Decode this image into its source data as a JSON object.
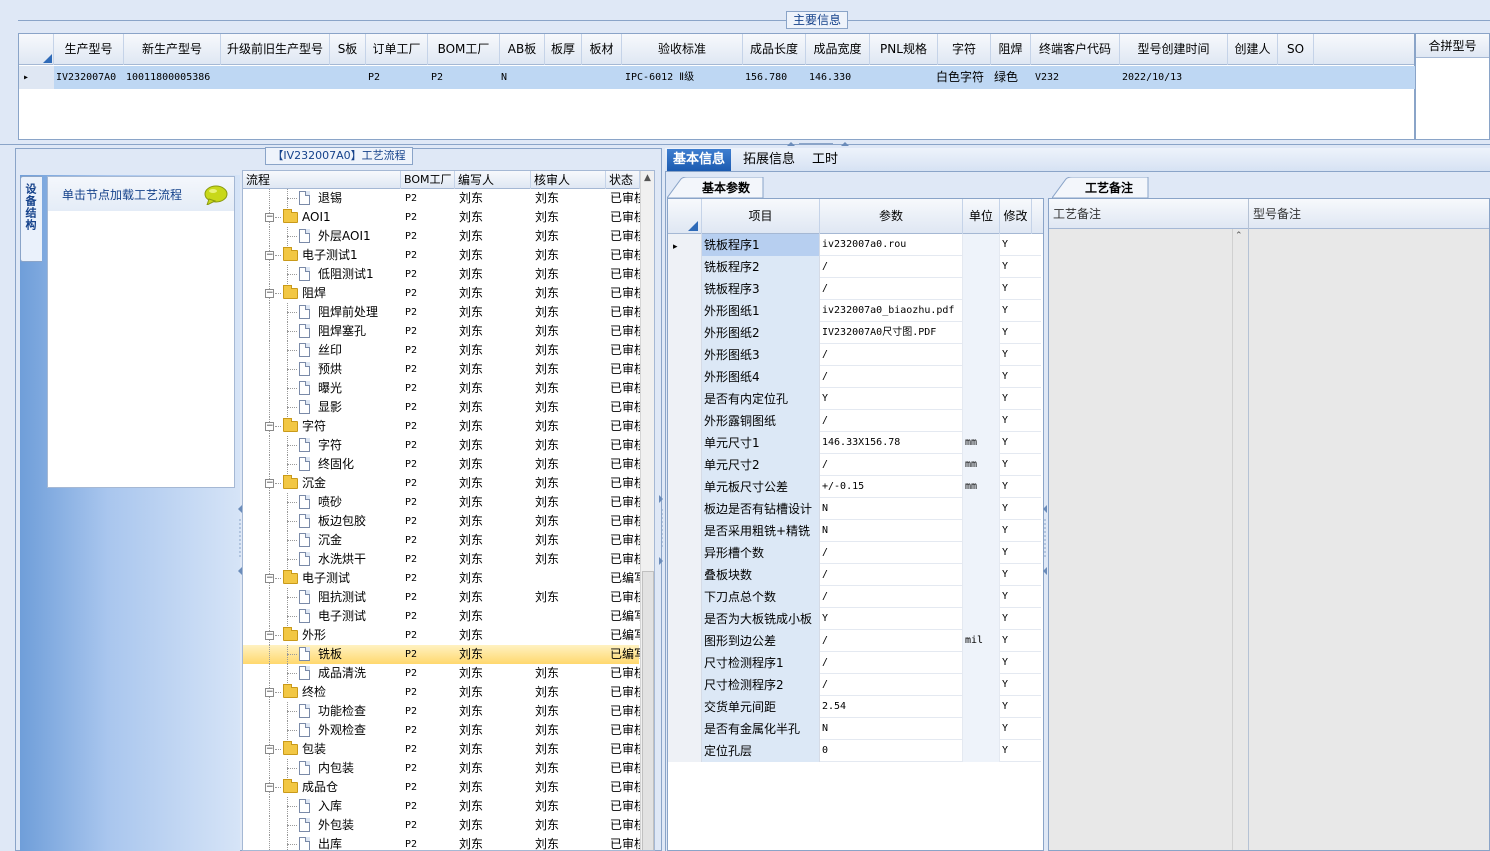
{
  "top": {
    "title": "主要信息",
    "columns": [
      "生产型号",
      "新生产型号",
      "升级前旧生产型号",
      "S板",
      "订单工厂",
      "BOM工厂",
      "AB板",
      "板厚",
      "板材",
      "验收标准",
      "成品长度",
      "成品宽度",
      "PNL规格",
      "字符",
      "阻焊",
      "终端客户代码",
      "型号创建时间",
      "创建人",
      "SO"
    ],
    "row": {
      "model": "IV232007A0",
      "new_model": "10011800005386",
      "order_factory": "P2",
      "bom_factory": "P2",
      "ab": "N",
      "standard": "IPC-6012 Ⅱ级",
      "length": "156.780",
      "width": "146.330",
      "char": "白色字符",
      "solder": "绿色",
      "customer": "V232",
      "created": "2022/10/13"
    },
    "merge_header": "合拼型号"
  },
  "left": {
    "flow_title": "【IV232007A0】工艺流程",
    "side_tab": "设备结构",
    "node_hint": "单击节点加载工艺流程",
    "tree_headers": [
      "流程",
      "BOM工厂",
      "编写人",
      "核审人",
      "状态"
    ],
    "tree_rows": [
      {
        "name": "退锡",
        "lvl": 2,
        "bom": "P2",
        "writer": "刘东",
        "checker": "刘东",
        "status": "已审核"
      },
      {
        "name": "AOI1",
        "lvl": 1,
        "bom": "P2",
        "writer": "刘东",
        "checker": "刘东",
        "status": "已审核"
      },
      {
        "name": "外层AOI1",
        "lvl": 2,
        "bom": "P2",
        "writer": "刘东",
        "checker": "刘东",
        "status": "已审核"
      },
      {
        "name": "电子测试1",
        "lvl": 1,
        "bom": "P2",
        "writer": "刘东",
        "checker": "刘东",
        "status": "已审核"
      },
      {
        "name": "低阻测试1",
        "lvl": 2,
        "bom": "P2",
        "writer": "刘东",
        "checker": "刘东",
        "status": "已审核"
      },
      {
        "name": "阻焊",
        "lvl": 1,
        "bom": "P2",
        "writer": "刘东",
        "checker": "刘东",
        "status": "已审核"
      },
      {
        "name": "阻焊前处理",
        "lvl": 2,
        "bom": "P2",
        "writer": "刘东",
        "checker": "刘东",
        "status": "已审核"
      },
      {
        "name": "阻焊塞孔",
        "lvl": 2,
        "bom": "P2",
        "writer": "刘东",
        "checker": "刘东",
        "status": "已审核"
      },
      {
        "name": "丝印",
        "lvl": 2,
        "bom": "P2",
        "writer": "刘东",
        "checker": "刘东",
        "status": "已审核"
      },
      {
        "name": "预烘",
        "lvl": 2,
        "bom": "P2",
        "writer": "刘东",
        "checker": "刘东",
        "status": "已审核"
      },
      {
        "name": "曝光",
        "lvl": 2,
        "bom": "P2",
        "writer": "刘东",
        "checker": "刘东",
        "status": "已审核"
      },
      {
        "name": "显影",
        "lvl": 2,
        "bom": "P2",
        "writer": "刘东",
        "checker": "刘东",
        "status": "已审核"
      },
      {
        "name": "字符",
        "lvl": 1,
        "bom": "P2",
        "writer": "刘东",
        "checker": "刘东",
        "status": "已审核"
      },
      {
        "name": "字符",
        "lvl": 2,
        "bom": "P2",
        "writer": "刘东",
        "checker": "刘东",
        "status": "已审核"
      },
      {
        "name": "终固化",
        "lvl": 2,
        "bom": "P2",
        "writer": "刘东",
        "checker": "刘东",
        "status": "已审核"
      },
      {
        "name": "沉金",
        "lvl": 1,
        "bom": "P2",
        "writer": "刘东",
        "checker": "刘东",
        "status": "已审核"
      },
      {
        "name": "喷砂",
        "lvl": 2,
        "bom": "P2",
        "writer": "刘东",
        "checker": "刘东",
        "status": "已审核"
      },
      {
        "name": "板边包胶",
        "lvl": 2,
        "bom": "P2",
        "writer": "刘东",
        "checker": "刘东",
        "status": "已审核"
      },
      {
        "name": "沉金",
        "lvl": 2,
        "bom": "P2",
        "writer": "刘东",
        "checker": "刘东",
        "status": "已审核"
      },
      {
        "name": "水洗烘干",
        "lvl": 2,
        "bom": "P2",
        "writer": "刘东",
        "checker": "刘东",
        "status": "已审核"
      },
      {
        "name": "电子测试",
        "lvl": 1,
        "bom": "P2",
        "writer": "刘东",
        "checker": "",
        "status": "已编写"
      },
      {
        "name": "阻抗测试",
        "lvl": 2,
        "bom": "P2",
        "writer": "刘东",
        "checker": "刘东",
        "status": "已审核"
      },
      {
        "name": "电子测试",
        "lvl": 2,
        "bom": "P2",
        "writer": "刘东",
        "checker": "",
        "status": "已编写"
      },
      {
        "name": "外形",
        "lvl": 1,
        "bom": "P2",
        "writer": "刘东",
        "checker": "",
        "status": "已编写"
      },
      {
        "name": "铣板",
        "lvl": 2,
        "bom": "P2",
        "writer": "刘东",
        "checker": "",
        "status": "已编写",
        "selected": true
      },
      {
        "name": "成品清洗",
        "lvl": 2,
        "bom": "P2",
        "writer": "刘东",
        "checker": "刘东",
        "status": "已审核"
      },
      {
        "name": "终检",
        "lvl": 1,
        "bom": "P2",
        "writer": "刘东",
        "checker": "刘东",
        "status": "已审核"
      },
      {
        "name": "功能检查",
        "lvl": 2,
        "bom": "P2",
        "writer": "刘东",
        "checker": "刘东",
        "status": "已审核"
      },
      {
        "name": "外观检查",
        "lvl": 2,
        "bom": "P2",
        "writer": "刘东",
        "checker": "刘东",
        "status": "已审核"
      },
      {
        "name": "包装",
        "lvl": 1,
        "bom": "P2",
        "writer": "刘东",
        "checker": "刘东",
        "status": "已审核"
      },
      {
        "name": "内包装",
        "lvl": 2,
        "bom": "P2",
        "writer": "刘东",
        "checker": "刘东",
        "status": "已审核"
      },
      {
        "name": "成品仓",
        "lvl": 1,
        "bom": "P2",
        "writer": "刘东",
        "checker": "刘东",
        "status": "已审核"
      },
      {
        "name": "入库",
        "lvl": 2,
        "bom": "P2",
        "writer": "刘东",
        "checker": "刘东",
        "status": "已审核"
      },
      {
        "name": "外包装",
        "lvl": 2,
        "bom": "P2",
        "writer": "刘东",
        "checker": "刘东",
        "status": "已审核"
      },
      {
        "name": "出库",
        "lvl": 2,
        "bom": "P2",
        "writer": "刘东",
        "checker": "刘东",
        "status": "已审核"
      }
    ]
  },
  "right": {
    "tabs": [
      "基本信息",
      "拓展信息",
      "工时"
    ],
    "param_tab": "基本参数",
    "note_tab": "工艺备注",
    "param_headers": [
      "项目",
      "参数",
      "单位",
      "修改"
    ],
    "params": [
      {
        "item": "铣板程序1",
        "value": "iv232007a0.rou",
        "unit": "",
        "mod": "Y"
      },
      {
        "item": "铣板程序2",
        "value": "/",
        "unit": "",
        "mod": "Y"
      },
      {
        "item": "铣板程序3",
        "value": "/",
        "unit": "",
        "mod": "Y"
      },
      {
        "item": "外形图纸1",
        "value": "iv232007a0_biaozhu.pdf",
        "unit": "",
        "mod": "Y"
      },
      {
        "item": "外形图纸2",
        "value": "IV232007A0尺寸图.PDF",
        "unit": "",
        "mod": "Y"
      },
      {
        "item": "外形图纸3",
        "value": "/",
        "unit": "",
        "mod": "Y"
      },
      {
        "item": "外形图纸4",
        "value": "/",
        "unit": "",
        "mod": "Y"
      },
      {
        "item": "是否有内定位孔",
        "value": "Y",
        "unit": "",
        "mod": "Y"
      },
      {
        "item": "外形露铜图纸",
        "value": "/",
        "unit": "",
        "mod": "Y"
      },
      {
        "item": "单元尺寸1",
        "value": "146.33X156.78",
        "unit": "mm",
        "mod": "Y"
      },
      {
        "item": "单元尺寸2",
        "value": "/",
        "unit": "mm",
        "mod": "Y"
      },
      {
        "item": "单元板尺寸公差",
        "value": "+/-0.15",
        "unit": "mm",
        "mod": "Y"
      },
      {
        "item": "板边是否有钻槽设计",
        "value": "N",
        "unit": "",
        "mod": "Y"
      },
      {
        "item": "是否采用粗铣+精铣",
        "value": "N",
        "unit": "",
        "mod": "Y"
      },
      {
        "item": "异形槽个数",
        "value": "/",
        "unit": "",
        "mod": "Y"
      },
      {
        "item": "叠板块数",
        "value": "/",
        "unit": "",
        "mod": "Y"
      },
      {
        "item": "下刀点总个数",
        "value": "/",
        "unit": "",
        "mod": "Y"
      },
      {
        "item": "是否为大板铣成小板",
        "value": "Y",
        "unit": "",
        "mod": "Y"
      },
      {
        "item": "图形到边公差",
        "value": "/",
        "unit": "mil",
        "mod": "Y"
      },
      {
        "item": "尺寸检测程序1",
        "value": "/",
        "unit": "",
        "mod": "Y"
      },
      {
        "item": "尺寸检测程序2",
        "value": "/",
        "unit": "",
        "mod": "Y"
      },
      {
        "item": "交货单元间距",
        "value": "2.54",
        "unit": "",
        "mod": "Y"
      },
      {
        "item": "是否有金属化半孔",
        "value": "N",
        "unit": "",
        "mod": "Y"
      },
      {
        "item": "定位孔层",
        "value": "0",
        "unit": "",
        "mod": "Y"
      }
    ],
    "note_headers": [
      "工艺备注",
      "型号备注"
    ]
  }
}
